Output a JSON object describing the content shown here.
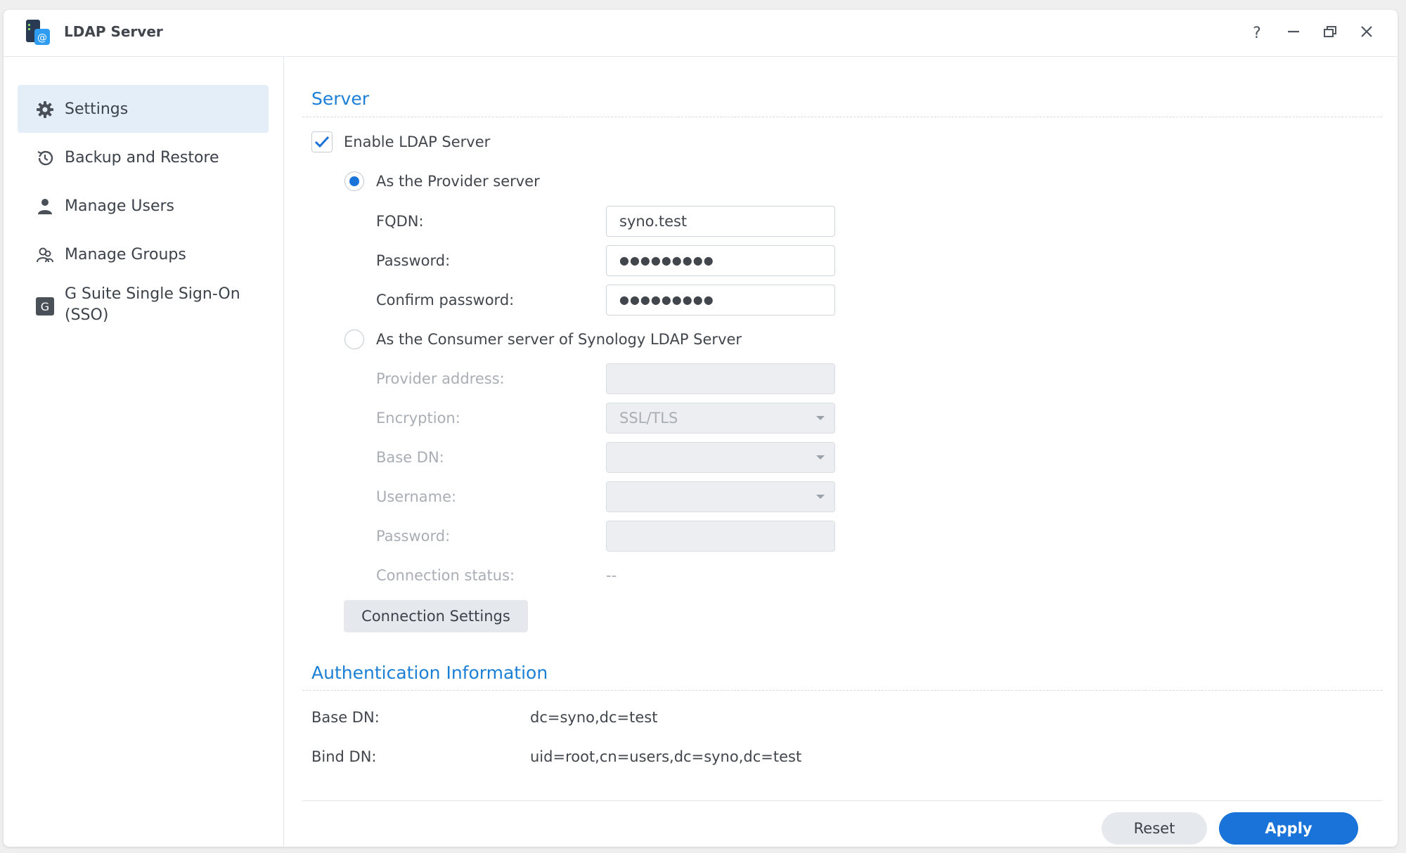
{
  "window": {
    "title": "LDAP Server",
    "controls": [
      "help-icon",
      "minimize-icon",
      "restore-icon",
      "close-icon"
    ],
    "help_glyph": "?"
  },
  "sidebar": {
    "items": [
      {
        "label": "Settings",
        "icon": "gear-icon",
        "active": true
      },
      {
        "label": "Backup and Restore",
        "icon": "history-icon",
        "active": false
      },
      {
        "label": "Manage Users",
        "icon": "user-icon",
        "active": false
      },
      {
        "label": "Manage Groups",
        "icon": "group-icon",
        "active": false
      },
      {
        "label": "G Suite Single Sign-On (SSO)",
        "icon": "g-suite-icon",
        "active": false
      }
    ],
    "g_icon_letter": "G"
  },
  "server": {
    "title": "Server",
    "enable_label": "Enable LDAP Server",
    "enable_checked": true,
    "provider": {
      "label": "As the Provider server",
      "selected": true,
      "fqdn_label": "FQDN:",
      "fqdn_value": "syno.test",
      "password_label": "Password:",
      "password_value": "●●●●●●●●●",
      "confirm_label": "Confirm password:",
      "confirm_value": "●●●●●●●●●"
    },
    "consumer": {
      "label": "As the Consumer server of Synology LDAP Server",
      "selected": false,
      "provider_address_label": "Provider address:",
      "provider_address_value": "",
      "encryption_label": "Encryption:",
      "encryption_value": "SSL/TLS",
      "base_dn_label": "Base DN:",
      "base_dn_value": "",
      "username_label": "Username:",
      "username_value": "",
      "password_label": "Password:",
      "password_value": "",
      "connection_status_label": "Connection status:",
      "connection_status_value": "--"
    },
    "connection_settings_button": "Connection Settings"
  },
  "auth": {
    "title": "Authentication Information",
    "base_dn_label": "Base DN:",
    "base_dn_value": "dc=syno,dc=test",
    "bind_dn_label": "Bind DN:",
    "bind_dn_value": "uid=root,cn=users,dc=syno,dc=test"
  },
  "footer": {
    "reset_label": "Reset",
    "apply_label": "Apply"
  },
  "colors": {
    "accent": "#1a73d9",
    "section_title": "#1b7fd6",
    "active_nav_bg": "#e3eef9"
  }
}
